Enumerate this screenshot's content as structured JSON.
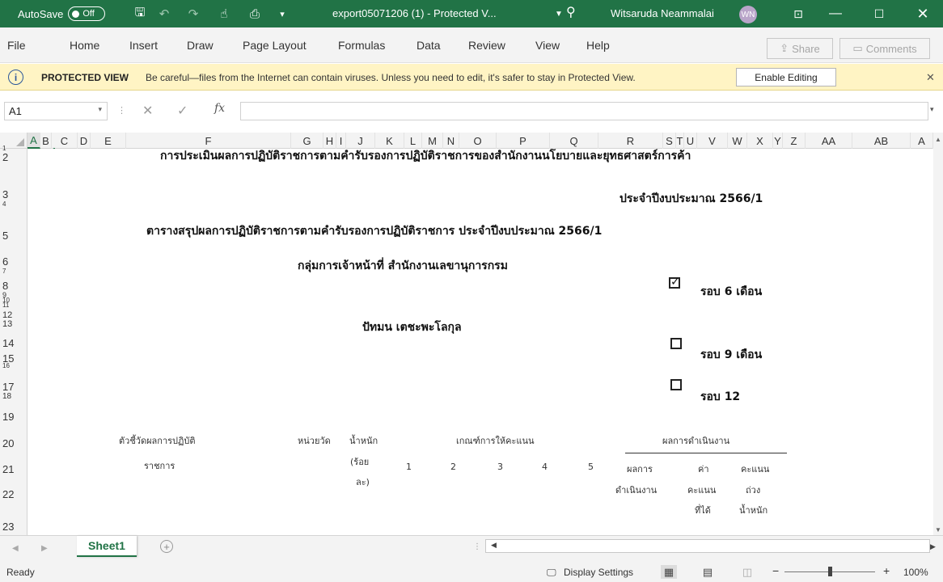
{
  "titlebar": {
    "autosave_label": "AutoSave",
    "autosave_state": "Off",
    "doc_title": "export05071206 (1)  -  Protected V...",
    "user_name": "Witsaruda Neammalai",
    "user_initials": "WN"
  },
  "menu": {
    "items": [
      "File",
      "Home",
      "Insert",
      "Draw",
      "Page Layout",
      "Formulas",
      "Data",
      "Review",
      "View",
      "Help"
    ],
    "share_label": "Share",
    "comments_label": "Comments"
  },
  "protected_view": {
    "title": "PROTECTED VIEW",
    "message": "Be careful—files from the Internet can contain viruses. Unless you need to edit, it's safer to stay in Protected View.",
    "enable_button": "Enable Editing"
  },
  "formula_bar": {
    "name_box": "A1",
    "fx_label": "fx",
    "formula": ""
  },
  "columns": [
    "A",
    "B",
    "C",
    "D",
    "E",
    "F",
    "G",
    "H",
    "I",
    "J",
    "K",
    "L",
    "M",
    "N",
    "O",
    "P",
    "Q",
    "R",
    "S",
    "T",
    "U",
    "V",
    "W",
    "X",
    "Y",
    "Z",
    "AA",
    "AB",
    "A"
  ],
  "rows": [
    "1",
    "2",
    "3",
    "4",
    "5",
    "6",
    "7",
    "8",
    "9",
    "10",
    "11",
    "12",
    "13",
    "14",
    "15",
    "16",
    "17",
    "18",
    "19",
    "20",
    "21",
    "22",
    "23"
  ],
  "content": {
    "title_line1": "การประเมินผลการปฏิบัติราชการตามคำรับรองการปฏิบัติราชการของสำนักงานนโยบายและยุทธศาสตร์การค้า",
    "title_line2": "ประจำปีงบประมาณ 2566/1",
    "subtitle": "ตารางสรุปผลการปฏิบัติราชการตามคำรับรองการปฏิบัติราชการ  ประจำปีงบประมาณ 2566/1",
    "group": "กลุ่มการเจ้าหน้าที่  สำนักงานเลขานุการกรม",
    "person": "ปัทมน เตชะพะโลกุล",
    "round6": "รอบ 6 เดือน",
    "round9": "รอบ 9 เดือน",
    "round12": "รอบ 12",
    "round6_checked": true,
    "round9_checked": false,
    "round12_checked": false,
    "hdr_indicator_1": "ตัวชี้วัดผลการปฏิบัติ",
    "hdr_indicator_2": "ราชการ",
    "hdr_unit": "หน่วยวัด",
    "hdr_weight_1": "น้ำหนัก",
    "hdr_weight_2": "(ร้อย",
    "hdr_weight_3": "ละ)",
    "hdr_criteria": "เกณฑ์การให้คะแนน",
    "hdr_result": "ผลการดำเนินงาน",
    "score_levels": [
      "1",
      "2",
      "3",
      "4",
      "5"
    ],
    "hdr_perf_1": "ผลการ",
    "hdr_perf_2": "ดำเนินงาน",
    "hdr_score_1": "ค่า",
    "hdr_score_2": "คะแนน",
    "hdr_score_3": "ที่ได้",
    "hdr_wscore_1": "คะแนน",
    "hdr_wscore_2": "ถ่วง",
    "hdr_wscore_3": "น้ำหนัก"
  },
  "tabs": {
    "sheet_name": "Sheet1"
  },
  "status": {
    "ready": "Ready",
    "display_settings": "Display Settings",
    "zoom": "100%"
  },
  "colors": {
    "excel_green": "#217346",
    "protected_bar": "#fff4c4"
  }
}
